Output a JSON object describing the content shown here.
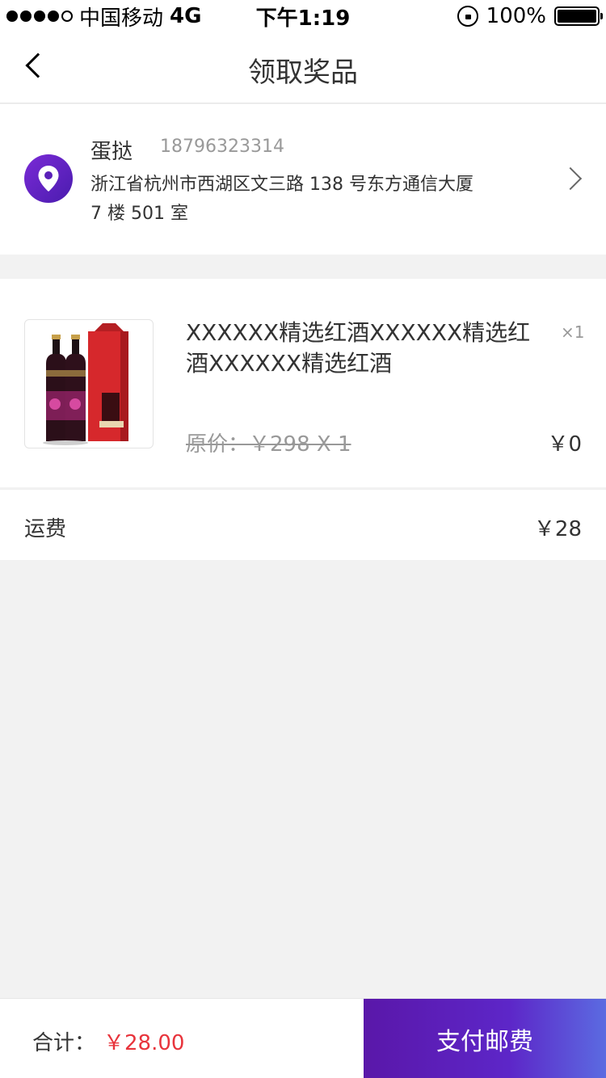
{
  "status_bar": {
    "carrier": "中国移动",
    "network": "4G",
    "time": "下午1:19",
    "battery": "100%"
  },
  "nav": {
    "title": "领取奖品"
  },
  "address": {
    "name": "蛋挞",
    "phone": "18796323314",
    "detail": "浙江省杭州市西湖区文三路 138 号东方通信大厦 7 楼 501 室"
  },
  "product": {
    "title": "XXXXXX精选红酒XXXXXX精选红酒XXXXXX精选红酒",
    "quantity": "×1",
    "original_price": "原价：￥298 X 1",
    "price": "￥0"
  },
  "shipping": {
    "label": "运费",
    "value": "￥28"
  },
  "footer": {
    "total_label": "合计：",
    "total_value": "￥28.00",
    "pay_button_label": "支付邮费"
  },
  "colors": {
    "accent": "#5a17a9",
    "price_red": "#e8343c",
    "background": "#f2f2f2"
  }
}
